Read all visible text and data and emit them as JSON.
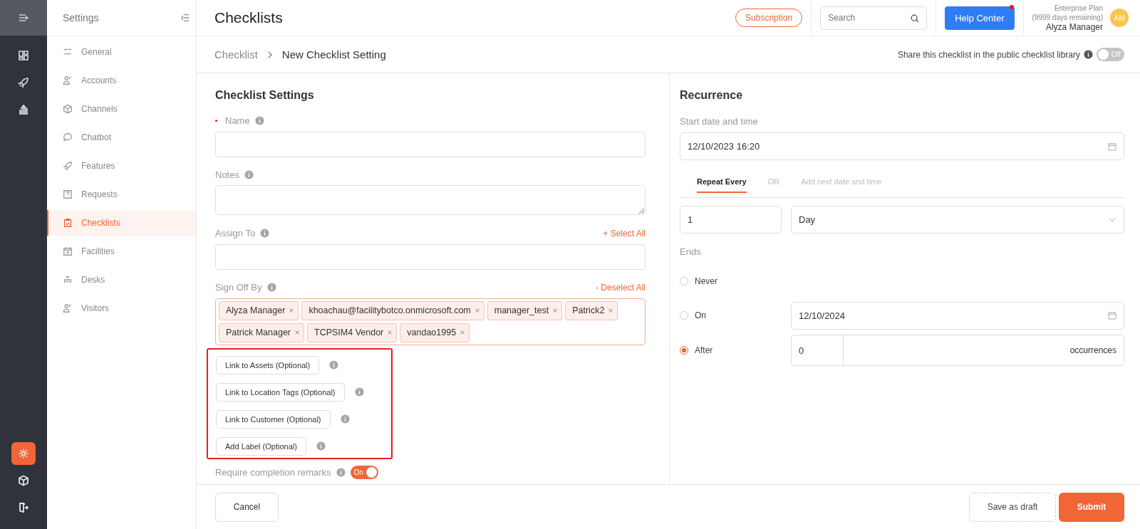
{
  "rail": {
    "items": [
      {
        "selected": false
      },
      {
        "selected": false
      },
      {
        "selected": false
      }
    ],
    "bottom_items": [
      {
        "selected": true
      },
      {
        "selected": false
      },
      {
        "selected": false
      }
    ]
  },
  "sidebar": {
    "title": "Settings",
    "items": [
      {
        "label": "General",
        "selected": false
      },
      {
        "label": "Accounts",
        "selected": false
      },
      {
        "label": "Channels",
        "selected": false
      },
      {
        "label": "Chatbot",
        "selected": false
      },
      {
        "label": "Features",
        "selected": false
      },
      {
        "label": "Requests",
        "selected": false
      },
      {
        "label": "Checklists",
        "selected": true
      },
      {
        "label": "Facilities",
        "selected": false
      },
      {
        "label": "Desks",
        "selected": false
      },
      {
        "label": "Visitors",
        "selected": false
      }
    ]
  },
  "header": {
    "title": "Checklists",
    "subscription": "Subscription",
    "search": {
      "placeholder": "Search"
    },
    "help": {
      "label": "Help Center",
      "notification": true
    },
    "plan": "Enterprise Plan",
    "days": "(9999 days remaining)",
    "user": "Alyza Manager",
    "avatar": "AM"
  },
  "breadcrumb": [
    "Checklist",
    "New Checklist Setting"
  ],
  "share": {
    "label": "Share this checklist in the public checklist library",
    "on": false,
    "state_label": "Off"
  },
  "form": {
    "title": "Checklist Settings",
    "name": {
      "label": "Name",
      "required": true
    },
    "notes": {
      "label": "Notes"
    },
    "assign": {
      "label": "Assign To",
      "action": "+ Select All"
    },
    "sign_off": {
      "label": "Sign Off By",
      "action": "- Deselect All",
      "tags": [
        "Alyza Manager",
        "khoachau@facilitybotco.onmicrosoft.com",
        "manager_test",
        "Patrick2",
        "Patrick Manager",
        "TCPSIM4 Vendor",
        "vandao1995"
      ]
    },
    "optional_buttons": [
      "Link to Assets (Optional)",
      "Link to Location Tags (Optional)",
      "Link to Customer (Optional)",
      "Add Label (Optional)"
    ],
    "remarks": {
      "label": "Require completion remarks",
      "on": true,
      "state_label": "On"
    }
  },
  "recurrence": {
    "title": "Recurrence",
    "start_label": "Start date and time",
    "start_value": "12/10/2023 16:20",
    "tabs": [
      {
        "label": "Repeat Every",
        "selected": true
      },
      {
        "label": "Add next date and time",
        "selected": false
      }
    ],
    "tab_separator": "OR",
    "interval": "1",
    "unit": "Day",
    "ends_label": "Ends",
    "ends": [
      {
        "kind": "plain",
        "label": "Never",
        "selected": false
      },
      {
        "kind": "date",
        "label": "On",
        "selected": false,
        "value": "12/10/2024"
      },
      {
        "kind": "count",
        "label": "After",
        "selected": true,
        "value": "0",
        "suffix": "occurrences"
      }
    ]
  },
  "footer": {
    "cancel": "Cancel",
    "draft": "Save as draft",
    "submit": "Submit"
  }
}
